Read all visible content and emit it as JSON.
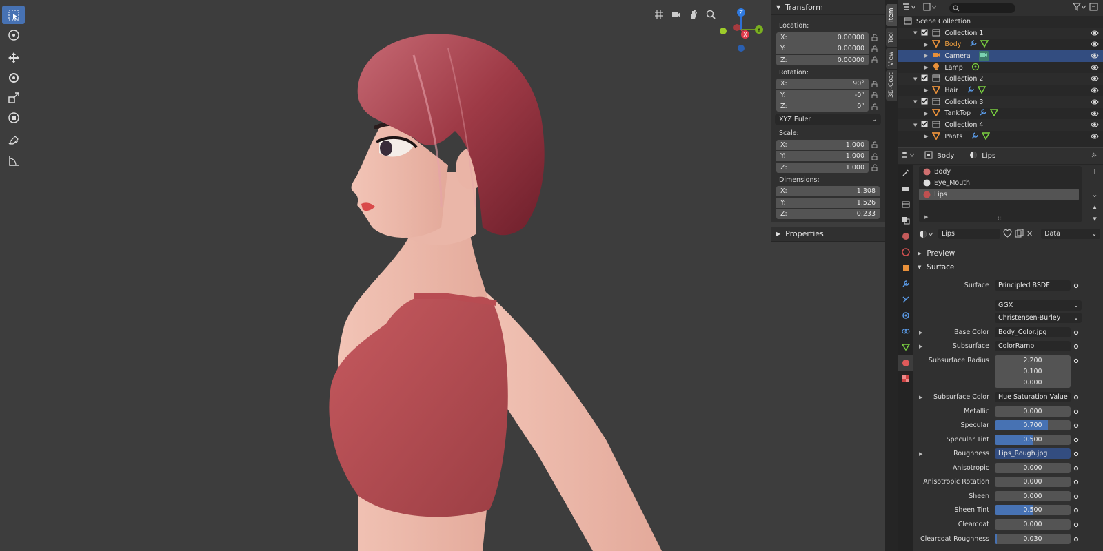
{
  "viewport": {
    "tools": [
      "select-box-icon",
      "cursor-icon",
      "move-icon",
      "rotate-icon",
      "scale-icon",
      "transform-icon",
      "annotate-icon",
      "measure-icon"
    ],
    "gizmo": {
      "z": "Z",
      "y": "Y",
      "x": "X"
    }
  },
  "npanel": {
    "transform_header": "Transform",
    "location_label": "Location:",
    "location": [
      {
        "axis": "X:",
        "value": "0.00000"
      },
      {
        "axis": "Y:",
        "value": "0.00000"
      },
      {
        "axis": "Z:",
        "value": "0.00000"
      }
    ],
    "rotation_label": "Rotation:",
    "rotation": [
      {
        "axis": "X:",
        "value": "90°"
      },
      {
        "axis": "Y:",
        "value": "-0°"
      },
      {
        "axis": "Z:",
        "value": "0°"
      }
    ],
    "rotation_mode": "XYZ Euler",
    "scale_label": "Scale:",
    "scale": [
      {
        "axis": "X:",
        "value": "1.000"
      },
      {
        "axis": "Y:",
        "value": "1.000"
      },
      {
        "axis": "Z:",
        "value": "1.000"
      }
    ],
    "dimensions_label": "Dimensions:",
    "dimensions": [
      {
        "axis": "X:",
        "value": "1.308"
      },
      {
        "axis": "Y:",
        "value": "1.526"
      },
      {
        "axis": "Z:",
        "value": "0.233"
      }
    ],
    "properties_header": "Properties",
    "tabs": [
      "Item",
      "Tool",
      "View",
      "3D-Coat"
    ]
  },
  "outliner": {
    "root": "Scene Collection",
    "rows": [
      {
        "name": "Collection 1",
        "kind": "collection"
      },
      {
        "name": "Body",
        "kind": "mesh"
      },
      {
        "name": "Camera",
        "kind": "camera"
      },
      {
        "name": "Lamp",
        "kind": "light"
      },
      {
        "name": "Collection 2",
        "kind": "collection"
      },
      {
        "name": "Hair",
        "kind": "mesh"
      },
      {
        "name": "Collection 3",
        "kind": "collection"
      },
      {
        "name": "TankTop",
        "kind": "mesh"
      },
      {
        "name": "Collection 4",
        "kind": "collection"
      },
      {
        "name": "Pants",
        "kind": "mesh"
      }
    ]
  },
  "properties": {
    "breadcrumb_object": "Body",
    "breadcrumb_material": "Lips",
    "materials": [
      "Body",
      "Eye_Mouth",
      "Lips"
    ],
    "material_name": "Lips",
    "link_mode": "Data",
    "preview_label": "Preview",
    "surface_label": "Surface",
    "rows": [
      {
        "label": "Surface",
        "value": "Principled BSDF",
        "type": "text"
      },
      {
        "label": "",
        "value": "GGX",
        "type": "dropdown"
      },
      {
        "label": "",
        "value": "Christensen-Burley",
        "type": "dropdown"
      },
      {
        "label": "Base Color",
        "value": "Body_Color.jpg",
        "type": "text",
        "expand": true
      },
      {
        "label": "Subsurface",
        "value": "ColorRamp",
        "type": "text",
        "expand": true
      },
      {
        "label": "Subsurface Radius",
        "value": "2.200",
        "type": "vec"
      },
      {
        "label": "",
        "value": "0.100",
        "type": "vec"
      },
      {
        "label": "",
        "value": "0.000",
        "type": "vec"
      },
      {
        "label": "Subsurface Color",
        "value": "Hue Saturation Value",
        "type": "text",
        "expand": true
      },
      {
        "label": "Metallic",
        "value": "0.000",
        "type": "num",
        "fill": 0
      },
      {
        "label": "Specular",
        "value": "0.700",
        "type": "num",
        "fill": 0.7
      },
      {
        "label": "Specular Tint",
        "value": "0.500",
        "type": "num",
        "fill": 0.5
      },
      {
        "label": "Roughness",
        "value": "Lips_Rough.jpg",
        "type": "text",
        "expand": true
      },
      {
        "label": "Anisotropic",
        "value": "0.000",
        "type": "num",
        "fill": 0
      },
      {
        "label": "Anisotropic Rotation",
        "value": "0.000",
        "type": "num",
        "fill": 0
      },
      {
        "label": "Sheen",
        "value": "0.000",
        "type": "num",
        "fill": 0
      },
      {
        "label": "Sheen Tint",
        "value": "0.500",
        "type": "num",
        "fill": 0.5
      },
      {
        "label": "Clearcoat",
        "value": "0.000",
        "type": "num",
        "fill": 0
      },
      {
        "label": "Clearcoat Roughness",
        "value": "0.030",
        "type": "num",
        "fill": 0.03
      }
    ]
  },
  "colors": {
    "accent": "#4772b3",
    "selected_row": "#334d80",
    "mesh_icon": "#e8903a",
    "bg": "#3d3d3d"
  }
}
